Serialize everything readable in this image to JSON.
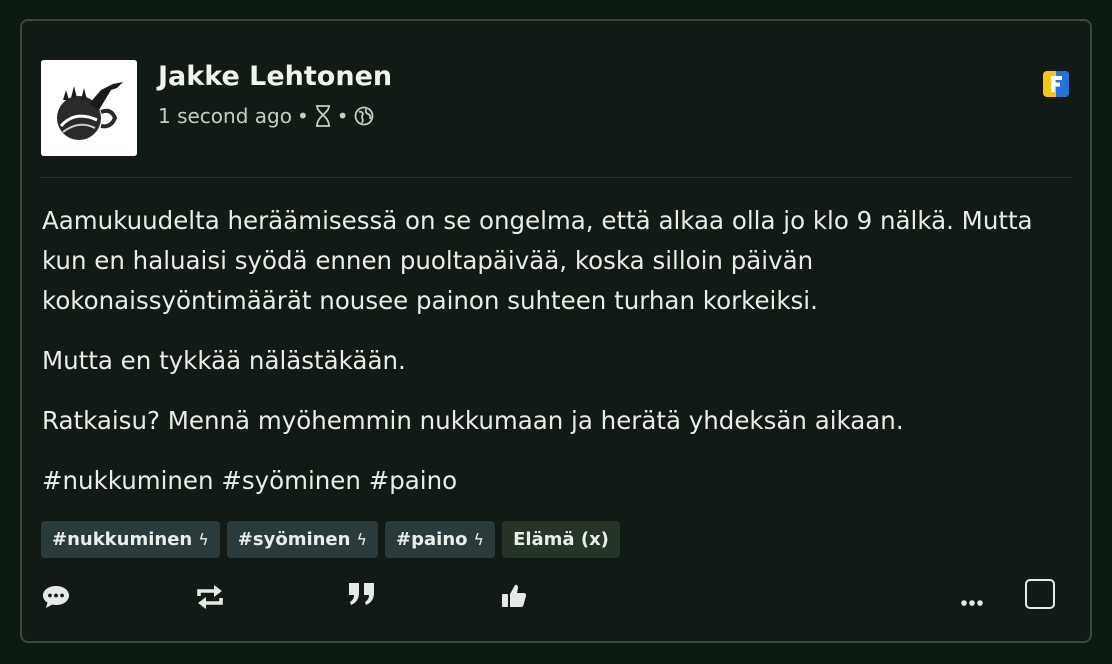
{
  "post": {
    "author": "Jakke Lehtonen",
    "time": "1 second ago",
    "sep": "•",
    "paragraphs": [
      "Aamukuudelta heräämisessä on se ongelma, että alkaa olla jo klo 9 nälkä. Mutta kun en haluaisi syödä ennen puoltapäivää, koska silloin päivän kokonaissyöntimäärät nousee painon suhteen turhan korkeiksi.",
      "Mutta en tykkää nälästäkään.",
      "Ratkaisu? Mennä myöhemmin nukkumaan ja herätä yhdeksän aikaan.",
      "#nukkuminen #syöminen #paino"
    ],
    "tags": [
      {
        "label": "#nukkuminen",
        "icon": "bolt-icon"
      },
      {
        "label": "#syöminen",
        "icon": "bolt-icon"
      },
      {
        "label": "#paino",
        "icon": "bolt-icon"
      }
    ],
    "category": "Elämä (x)",
    "bolt_glyph": "ϟ"
  },
  "icons": {
    "time": "hourglass-icon",
    "visibility": "globe-icon",
    "app": "app-logo-icon",
    "actions": [
      "comment-icon",
      "repeat-icon",
      "quote-icon",
      "thumbs-up-icon",
      "more-icon"
    ]
  },
  "colors": {
    "background": "#0c1a10",
    "card": "#121a15",
    "tag": "#2b3a3b",
    "category": "#263528",
    "app_blue": "#2573d8",
    "app_yellow": "#f5c518"
  }
}
